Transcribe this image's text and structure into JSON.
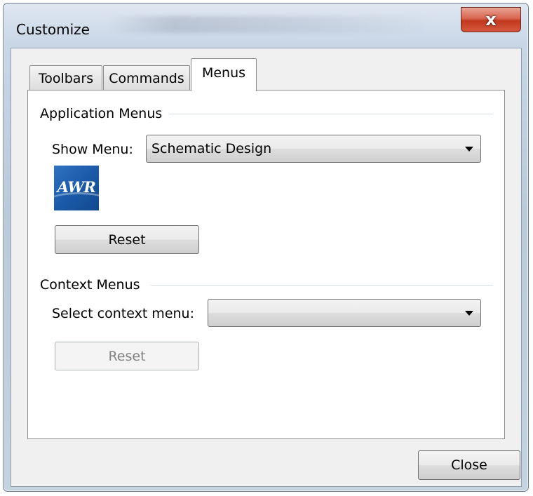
{
  "window": {
    "title": "Customize",
    "close_glyph": "x"
  },
  "tabs": [
    {
      "label": "Toolbars",
      "selected": false
    },
    {
      "label": "Commands",
      "selected": false
    },
    {
      "label": "Menus",
      "selected": true
    }
  ],
  "application_menus": {
    "group_label": "Application Menus",
    "show_menu_label": "Show Menu:",
    "show_menu_value": "Schematic Design",
    "logo_text": "AWR",
    "reset_label": "Reset",
    "reset_enabled": true
  },
  "context_menus": {
    "group_label": "Context Menus",
    "select_label": "Select context menu:",
    "select_value": "",
    "reset_label": "Reset",
    "reset_enabled": false
  },
  "footer": {
    "close_label": "Close"
  },
  "colors": {
    "close_button_red": "#c0391f",
    "logo_blue": "#1b5aa8"
  }
}
